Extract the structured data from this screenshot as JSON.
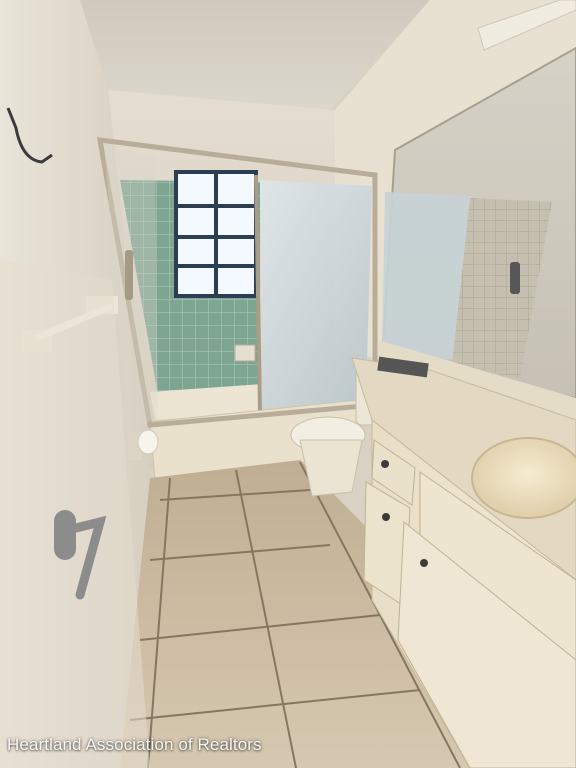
{
  "photo": {
    "watermark_text": "Heartland Association of Realtors"
  },
  "colors": {
    "wall": "#e6e0d3",
    "ceiling": "#d8d3c8",
    "floor_tile": "#c9bba2",
    "grout": "#8a7b66",
    "shower_tile": "#7fa694",
    "cabinet": "#efe6cf",
    "countertop": "#e2d8c2",
    "sink": "#efe2c2",
    "glass": "#c9d3d6",
    "frame_metal": "#b8ad98",
    "window_light": "#f4f8ff"
  }
}
